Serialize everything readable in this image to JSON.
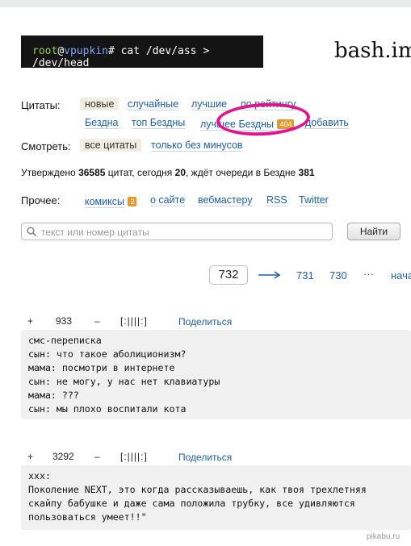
{
  "header": {
    "terminal": {
      "user": "root",
      "at": "@",
      "host": "vpupkin",
      "command": "# cat /dev/ass > /dev/head"
    },
    "site_name": "bash.im"
  },
  "nav": {
    "quotes_label": "Цитаты:",
    "quotes_row1": [
      "новые",
      "случайные",
      "лучшие",
      "по рейтингу"
    ],
    "quotes_row2": {
      "abyss": "Бездна",
      "abyss_top": "топ Бездны",
      "abyss_best": "лучшее Бездны",
      "abyss_count": "404",
      "add": "добавить"
    },
    "view_label": "Смотреть:",
    "view_all": "все цитаты",
    "view_no_minus": "только без минусов"
  },
  "stats": {
    "approved_prefix": "Утверждено",
    "approved_count": "36585",
    "today_prefix": "цитат, сегодня",
    "today_count": "20",
    "queue_prefix": ", ждёт очереди в Бездне",
    "queue_count": "381"
  },
  "other": {
    "label": "Прочее:",
    "comics": "комиксы",
    "comics_badge": "2",
    "about": "о сайте",
    "webmaster": "вебмастеру",
    "rss": "RSS",
    "twitter": "Twitter"
  },
  "search": {
    "placeholder": "текст или номер цитаты",
    "button": "Найти"
  },
  "pager": {
    "current": "732",
    "arrow": "⟶",
    "next1": "731",
    "next2": "730",
    "ellipsis": "···",
    "start": "начало"
  },
  "quotes": [
    {
      "plus": "+",
      "rating": "933",
      "minus": "–",
      "bayan": "[:||||:]",
      "share": "Поделиться",
      "lines": [
        "смс-переписка",
        "сын: что такое аболиционизм?",
        "мама: посмотри в интернете",
        "сын: не могу, у нас нет клавиатуры",
        "мама: ???",
        "сын: мы плохо воспитали кота"
      ]
    },
    {
      "plus": "+",
      "rating": "3292",
      "minus": "–",
      "bayan": "[:||||:]",
      "share": "Поделиться",
      "lines": [
        "xxx:",
        "Поколение NEXT, это когда рассказываешь, как твоя трехлетняя",
        "скайпу бабушке и даже сама положила трубку, все удивляются",
        "пользоваться умеет!!\""
      ]
    }
  ],
  "watermark": "pikabu.ru",
  "colors": {
    "link": "#1d5fa8",
    "badge": "#e09a2d",
    "highlight_ring": "#e4128f",
    "terminal_bg": "#141414",
    "quote_bg": "#f0f0f0"
  }
}
